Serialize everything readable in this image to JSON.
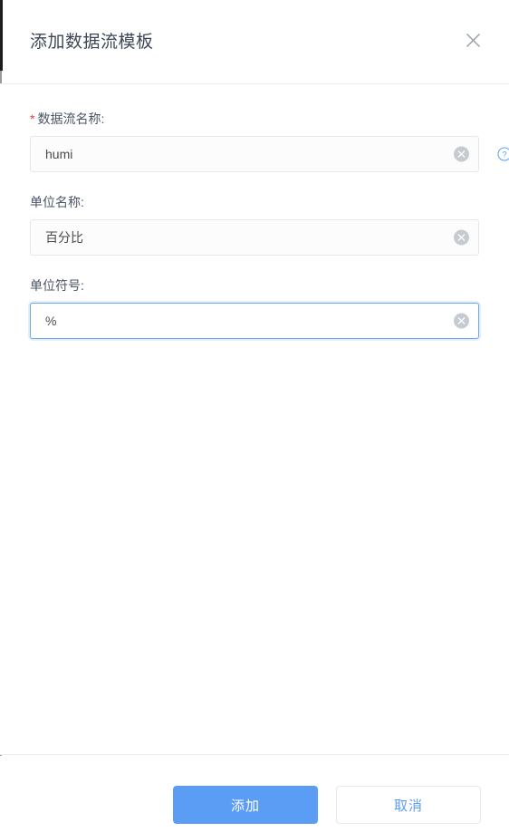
{
  "dialog": {
    "title": "添加数据流模板",
    "close_icon": "close-icon"
  },
  "form": {
    "fields": [
      {
        "label": "数据流名称:",
        "required": true,
        "required_marker": "*",
        "value": "humi",
        "placeholder": "",
        "focused": false,
        "has_clear": true,
        "has_help": true,
        "clear_icon": "clear-circle-icon",
        "help_icon": "question-mark-icon"
      },
      {
        "label": "单位名称:",
        "required": false,
        "required_marker": "",
        "value": "百分比",
        "placeholder": "",
        "focused": false,
        "has_clear": true,
        "has_help": false,
        "clear_icon": "clear-circle-icon",
        "help_icon": ""
      },
      {
        "label": "单位符号:",
        "required": false,
        "required_marker": "",
        "value": "%",
        "placeholder": "",
        "focused": true,
        "has_clear": true,
        "has_help": false,
        "clear_icon": "clear-circle-icon",
        "help_icon": ""
      }
    ]
  },
  "footer": {
    "submit_label": "添加",
    "cancel_label": "取消"
  },
  "colors": {
    "accent": "#5b9cf5",
    "required_star": "#e8384f",
    "title_text": "#3d4757",
    "label_text": "#4c5565",
    "input_border": "#e4e7ec",
    "focus_border": "#6aa9e9",
    "clear_icon_fill": "#c6cbd2",
    "divider": "#ececec"
  }
}
